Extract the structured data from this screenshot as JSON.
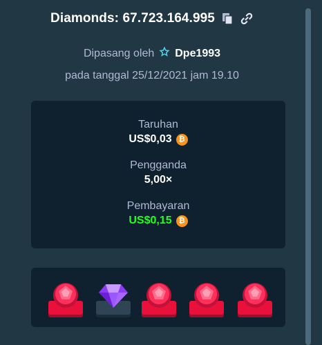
{
  "header": {
    "title": "Diamonds: 67.723.164.995",
    "copy_icon": "copy-icon",
    "link_icon": "link-icon"
  },
  "meta": {
    "placed_by_prefix": "Dipasang oleh",
    "username": "Dpe1993",
    "user_badge_icon": "star-badge-icon",
    "date_line": "pada tanggal 25/12/2021 jam 19.10"
  },
  "stats": {
    "bet_label": "Taruhan",
    "bet_value": "US$0,03",
    "multiplier_label": "Pengganda",
    "multiplier_value": "5,00×",
    "payout_label": "Pembayaran",
    "payout_value": "US$0,15",
    "currency_icon": "bitcoin-icon",
    "currency_symbol": "₿"
  },
  "gems": [
    "ruby",
    "amethyst",
    "ruby",
    "ruby",
    "ruby"
  ],
  "colors": {
    "page_bg": "#213743",
    "card_bg": "#0f212e",
    "payout_green": "#1fff20",
    "ruby_red": "#e9113c",
    "badge_cyan": "#4fd1e8",
    "coin_orange": "#f7931a"
  }
}
